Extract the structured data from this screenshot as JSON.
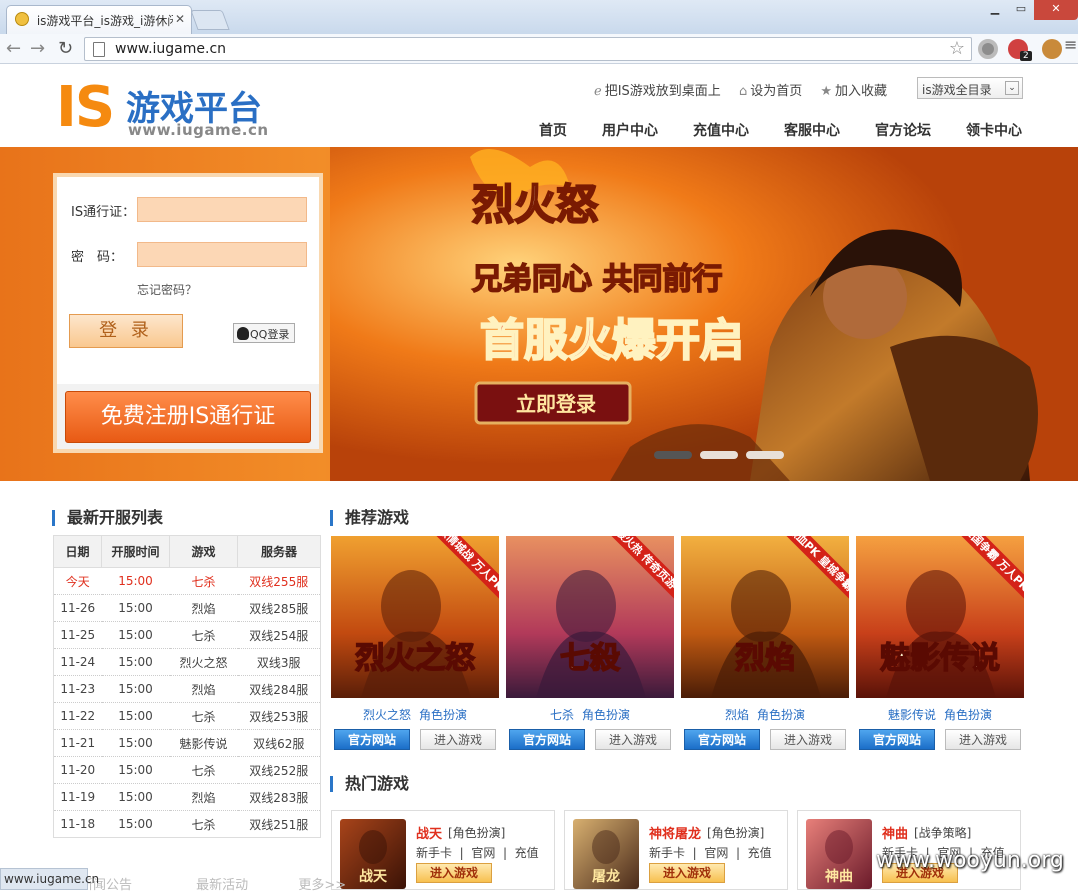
{
  "browser": {
    "tab_title": "is游戏平台_is游戏_i游休闲",
    "url": "www.iugame.cn",
    "status_url": "www.iugame.cn",
    "ext_badge": "2"
  },
  "header": {
    "logo_is": "IS",
    "logo_title": "游戏平台",
    "logo_url": "www.iugame.cn",
    "toplinks": [
      "把IS游戏放到桌面上",
      "设为首页",
      "加入收藏"
    ],
    "directory_button": "is游戏全目录",
    "nav": [
      "首页",
      "用户中心",
      "充值中心",
      "客服中心",
      "官方论坛",
      "领卡中心"
    ]
  },
  "login": {
    "account_label": "IS通行证：",
    "password_label": "密　码：",
    "forgot": "忘记密码？",
    "login_button": "登 录",
    "qq_login": "QQ登录",
    "register_button": "免费注册IS通行证"
  },
  "banner": {
    "game_logo": "烈火怒",
    "slogan": "兄弟同心 共同前行",
    "headline": "首服火爆开启",
    "cta": "立即登录"
  },
  "server_list": {
    "title": "最新开服列表",
    "columns": [
      "日期",
      "开服时间",
      "游戏",
      "服务器"
    ],
    "rows": [
      [
        "今天",
        "15:00",
        "七杀",
        "双线255服"
      ],
      [
        "11-26",
        "15:00",
        "烈焰",
        "双线285服"
      ],
      [
        "11-25",
        "15:00",
        "七杀",
        "双线254服"
      ],
      [
        "11-24",
        "15:00",
        "烈火之怒",
        "双线3服"
      ],
      [
        "11-23",
        "15:00",
        "烈焰",
        "双线284服"
      ],
      [
        "11-22",
        "15:00",
        "七杀",
        "双线253服"
      ],
      [
        "11-21",
        "15:00",
        "魅影传说",
        "双线62服"
      ],
      [
        "11-20",
        "15:00",
        "七杀",
        "双线252服"
      ],
      [
        "11-19",
        "15:00",
        "烈焰",
        "双线283服"
      ],
      [
        "11-18",
        "15:00",
        "七杀",
        "双线251服"
      ]
    ]
  },
  "recommended": {
    "title": "推荐游戏",
    "official_label": "官方网站",
    "enter_label": "进入游戏",
    "games": [
      {
        "name": "烈火之怒",
        "type": "角色扮演",
        "ribbon": "激情城战 万人PK",
        "art": "烈火之怒"
      },
      {
        "name": "七杀",
        "type": "角色扮演",
        "ribbon": "最火热 传奇页游",
        "art": "七殺"
      },
      {
        "name": "烈焰",
        "type": "角色扮演",
        "ribbon": "热血PK 皇城争霸",
        "art": "烈焰"
      },
      {
        "name": "魅影传说",
        "type": "角色扮演",
        "ribbon": "三国争霸 万人PK",
        "art": "魅影传说"
      }
    ]
  },
  "hot": {
    "title": "热门游戏",
    "links": [
      "新手卡",
      "官网",
      "充值"
    ],
    "enter_label": "进入游戏",
    "games": [
      {
        "name": "战天",
        "category": "[角色扮演]",
        "art": "战天"
      },
      {
        "name": "神将屠龙",
        "category": "[角色扮演]",
        "art": "屠龙"
      },
      {
        "name": "神曲",
        "category": "[战争策略]",
        "art": "神曲"
      }
    ]
  },
  "faded_tabs": [
    "新闻公告",
    "最新活动",
    "更多>>"
  ],
  "watermark": "www.wooyun.org",
  "colors": {
    "accent_orange": "#f58a10",
    "brand_blue": "#2a6fc4",
    "highlight_red": "#e0301e"
  }
}
